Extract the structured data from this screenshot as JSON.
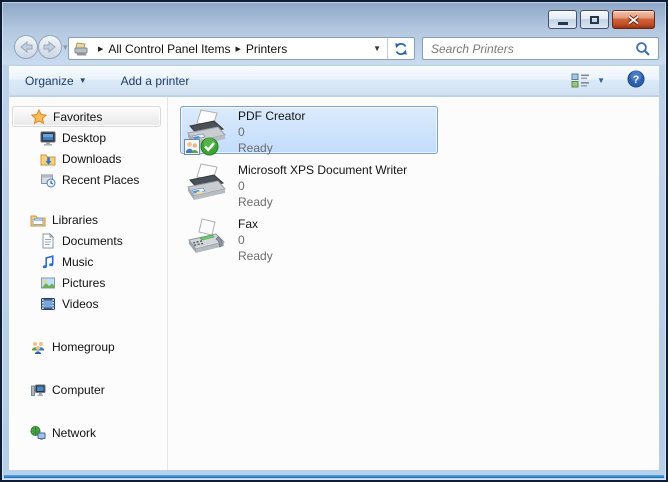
{
  "window_title": "",
  "navbar": {
    "breadcrumb_items": [
      "All Control Panel Items",
      "Printers"
    ],
    "search_placeholder": "Search Printers"
  },
  "toolbar": {
    "organize": "Organize",
    "add_printer": "Add a printer"
  },
  "icons": {
    "breadcrumb_separator": "▶",
    "address_dropdown": "▼",
    "organize_dropdown": "▼",
    "views_dropdown": "▼",
    "nav_history_dropdown": "▾"
  },
  "sidebar": {
    "items": [
      {
        "label": "Favorites",
        "icon": "star-icon",
        "selected": true
      },
      {
        "label": "Desktop",
        "icon": "desktop-icon"
      },
      {
        "label": "Downloads",
        "icon": "downloads-icon"
      },
      {
        "label": "Recent Places",
        "icon": "recent-places-icon"
      },
      {
        "label": "Libraries",
        "icon": "libraries-icon"
      },
      {
        "label": "Documents",
        "icon": "documents-icon"
      },
      {
        "label": "Music",
        "icon": "music-icon"
      },
      {
        "label": "Pictures",
        "icon": "pictures-icon"
      },
      {
        "label": "Videos",
        "icon": "videos-icon"
      },
      {
        "label": "Homegroup",
        "icon": "homegroup-icon"
      },
      {
        "label": "Computer",
        "icon": "computer-icon"
      },
      {
        "label": "Network",
        "icon": "network-icon"
      }
    ]
  },
  "printers": {
    "items": [
      {
        "name": "PDF Creator",
        "documents": "0",
        "status": "Ready",
        "selected": true,
        "shared": true,
        "default": true
      },
      {
        "name": "Microsoft XPS Document Writer",
        "documents": "0",
        "status": "Ready"
      },
      {
        "name": "Fax",
        "documents": "0",
        "status": "Ready"
      }
    ]
  },
  "colors": {
    "selection_border": "#7da2ce",
    "selection_fill": "#dcebfc",
    "accent_blue": "#2a62ad",
    "status_text": "#6d6d6d",
    "close_button": "#c14f28"
  }
}
